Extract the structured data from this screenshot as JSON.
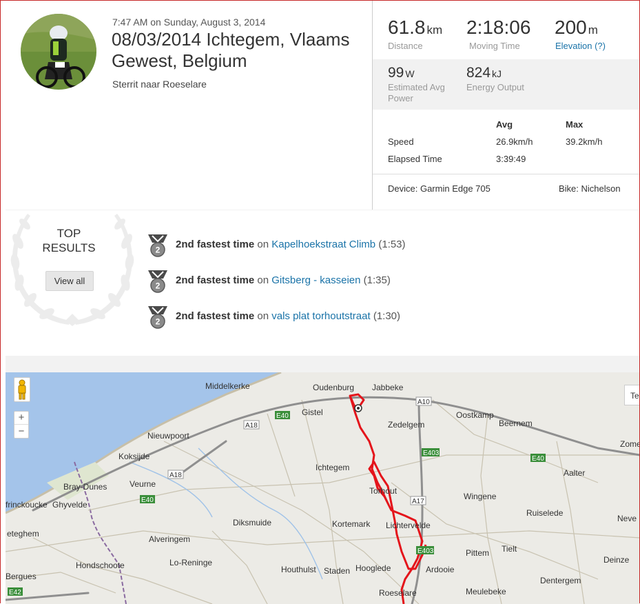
{
  "activity": {
    "timestamp": "7:47 AM on Sunday, August 3, 2014",
    "title": "08/03/2014 Ichtegem, Vlaams Gewest, Belgium",
    "description": "Sterrit naar Roeselare"
  },
  "stats": {
    "distance": {
      "value": "61.8",
      "unit": "km",
      "label": "Distance"
    },
    "moving_time": {
      "value": "2:18:06",
      "label": "Moving Time"
    },
    "elevation": {
      "value": "200",
      "unit": "m",
      "label": "Elevation (?)"
    },
    "power": {
      "value": "99",
      "unit": "W",
      "label": "Estimated Avg Power"
    },
    "energy": {
      "value": "824",
      "unit": "kJ",
      "label": "Energy Output"
    }
  },
  "table": {
    "col_avg": "Avg",
    "col_max": "Max",
    "rows": [
      {
        "label": "Speed",
        "avg": "26.9km/h",
        "max": "39.2km/h"
      },
      {
        "label": "Elapsed Time",
        "avg": "3:39:49",
        "max": ""
      }
    ],
    "device": "Device: Garmin Edge 705",
    "bike": "Bike: Nichelson"
  },
  "top_results": {
    "title_line1": "TOP",
    "title_line2": "RESULTS",
    "view_all": "View all",
    "items": [
      {
        "rank_text": "2nd fastest time",
        "on": "on",
        "segment": "Kapelhoekstraat Climb",
        "time": "(1:53)",
        "badge": "2"
      },
      {
        "rank_text": "2nd fastest time",
        "on": "on",
        "segment": "Gitsberg - kasseien",
        "time": "(1:35)",
        "badge": "2"
      },
      {
        "rank_text": "2nd fastest time",
        "on": "on",
        "segment": "vals plat torhoutstraat",
        "time": "(1:30)",
        "badge": "2"
      }
    ]
  },
  "map": {
    "zoom_in": "+",
    "zoom_out": "−",
    "right_edge_label": "Te",
    "towns": [
      "Middelkerke",
      "Oudenburg",
      "Jabbeke",
      "Gistel",
      "Oostkamp",
      "Zedelgem",
      "Beernem",
      "Nieuwpoort",
      "Koksijde",
      "Ichtegem",
      "Aalter",
      "Bray-Dunes",
      "Veurne",
      "Torhout",
      "Wingene",
      "Zome",
      "frinckoucke",
      "Ghyvelde",
      "Diksmuide",
      "Ruiselede",
      "Neve",
      "eteghem",
      "Alveringem",
      "Kortemark",
      "Lichtervelde",
      "Tielt",
      "Pittem",
      "Hondschoote",
      "Lo-Reninge",
      "Houthulst",
      "Staden",
      "Hooglede",
      "Ardooie",
      "Deinze",
      "Bergues",
      "Dentergem",
      "Roeselare",
      "Meulebeke"
    ],
    "roads": [
      "A10",
      "A18",
      "E40",
      "A18",
      "E403",
      "E40",
      "A17",
      "E40",
      "E403",
      "E42"
    ],
    "colors": {
      "route": "#e4141b",
      "sea": "#a4c4ea",
      "land": "#ecebe6",
      "highway": "#8f8f8f"
    }
  }
}
